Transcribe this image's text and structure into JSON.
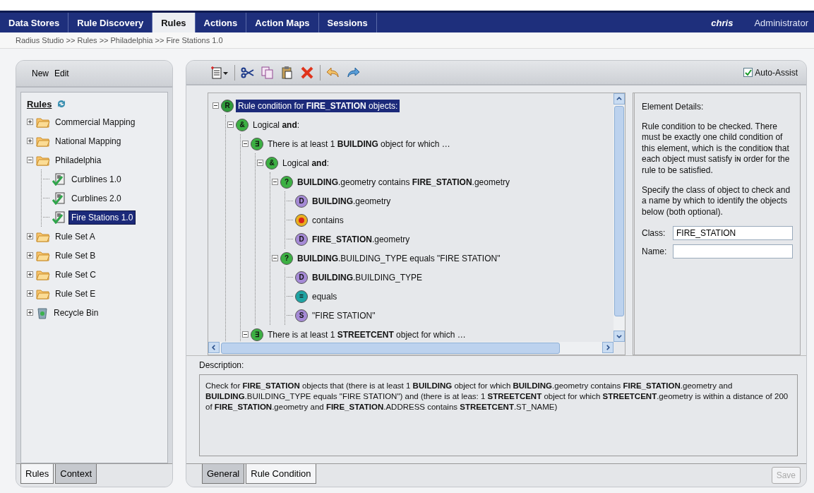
{
  "nav": {
    "tabs": [
      {
        "label": "Data Stores",
        "selected": false
      },
      {
        "label": "Rule Discovery",
        "selected": false
      },
      {
        "label": "Rules",
        "selected": true
      },
      {
        "label": "Actions",
        "selected": false
      },
      {
        "label": "Action Maps",
        "selected": false
      },
      {
        "label": "Sessions",
        "selected": false
      }
    ],
    "user": "chris",
    "role": "Administrator"
  },
  "breadcrumb": "Radius Studio >> Rules >> Philadelphia >> Fire Stations 1.0",
  "sidebar": {
    "menu": [
      "New",
      "Edit"
    ],
    "title": "Rules",
    "tree": [
      {
        "label": "Commercial Mapping",
        "kind": "folder",
        "expanded": false,
        "selected": false
      },
      {
        "label": "National Mapping",
        "kind": "folder",
        "expanded": false,
        "selected": false
      },
      {
        "label": "Philadelphia",
        "kind": "folder",
        "expanded": true,
        "selected": false,
        "children": [
          {
            "label": "Curblines 1.0",
            "kind": "rule",
            "selected": false
          },
          {
            "label": "Curblines 2.0",
            "kind": "rule",
            "selected": false
          },
          {
            "label": "Fire Stations 1.0",
            "kind": "rule",
            "selected": true
          }
        ]
      },
      {
        "label": "Rule Set A",
        "kind": "folder",
        "expanded": false,
        "selected": false
      },
      {
        "label": "Rule Set B",
        "kind": "folder",
        "expanded": false,
        "selected": false
      },
      {
        "label": "Rule Set C",
        "kind": "folder",
        "expanded": false,
        "selected": false
      },
      {
        "label": "Rule Set E",
        "kind": "folder",
        "expanded": false,
        "selected": false
      },
      {
        "label": "Recycle Bin",
        "kind": "bin",
        "expanded": false,
        "selected": false
      }
    ],
    "tabs": [
      {
        "label": "Rules",
        "selected": true
      },
      {
        "label": "Context",
        "selected": false
      }
    ]
  },
  "editor": {
    "auto_assist": {
      "label": "Auto-Assist",
      "checked": true
    },
    "condition_tree": [
      {
        "badge": "R",
        "kind": "rule",
        "text": "Rule condition for **FIRE_STATION** objects:",
        "expanded": true,
        "selected": true,
        "children": [
          {
            "badge": "&",
            "kind": "logical",
            "text": "Logical **and**:",
            "expanded": true,
            "selected": false,
            "children": [
              {
                "badge": "∃",
                "kind": "exists",
                "text": "There is at least 1 **BUILDING** object for which …",
                "expanded": true,
                "selected": false,
                "children": [
                  {
                    "badge": "&",
                    "kind": "logical",
                    "text": "Logical **and**:",
                    "expanded": true,
                    "selected": false,
                    "children": [
                      {
                        "badge": "?",
                        "kind": "test",
                        "text": "**BUILDING**.geometry contains **FIRE_STATION**.geometry",
                        "expanded": true,
                        "selected": false,
                        "children": [
                          {
                            "badge": "D",
                            "kind": "data",
                            "text": "**BUILDING**.geometry",
                            "selected": false
                          },
                          {
                            "kind": "operator",
                            "text": "contains",
                            "selected": false
                          },
                          {
                            "badge": "D",
                            "kind": "data",
                            "text": "**FIRE_STATION**.geometry",
                            "selected": false
                          }
                        ]
                      },
                      {
                        "badge": "?",
                        "kind": "test",
                        "text": "**BUILDING**.BUILDING_TYPE equals \"FIRE STATION\"",
                        "expanded": true,
                        "selected": false,
                        "children": [
                          {
                            "badge": "D",
                            "kind": "data",
                            "text": "**BUILDING**.BUILDING_TYPE",
                            "selected": false
                          },
                          {
                            "badge": "=",
                            "kind": "equals",
                            "text": "equals",
                            "selected": false
                          },
                          {
                            "badge": "S",
                            "kind": "string",
                            "text": "\"FIRE STATION\"",
                            "selected": false
                          }
                        ]
                      }
                    ]
                  }
                ]
              },
              {
                "badge": "∃",
                "kind": "exists",
                "text": "There is at least 1 **STREETCENT** object for which …",
                "expanded": true,
                "selected": false
              }
            ]
          }
        ]
      }
    ],
    "details": {
      "title": "Element Details:",
      "paragraphs": [
        "Rule condition to be checked. There must be exactly one child condition of this element, which is the conditioɴ that each object must satisfy iɴ order for the rule to be satisfied.",
        "Specify the class of object to check and a name by which to identify the objects below (both optional)."
      ],
      "fields": [
        {
          "label": "Class:",
          "value": "FIRE_STATION"
        },
        {
          "label": "Name:"
        }
      ]
    },
    "description": {
      "label": "Description:",
      "text": "Check for **FIRE_STATION** objects that (there is at least 1 **BUILDING** object for which **BUILDING**.geometry contains **FIRE_STATION**.geometry and **BUILDING**.BUILDING_TYPE equals \"FIRE STATION\") and (there is at leas: 1 **STREETCENT** object for which **STREETCENT**.geometry is within a distance of 200 of **FIRE_STATION**.geometry and **FIRE_STATION**.ADDRESS contains **STREETCENT**.ST_NAME)"
    },
    "tabs": [
      {
        "label": "General",
        "selected": false
      },
      {
        "label": "Rule Condition",
        "selected": true
      }
    ],
    "save": {
      "label": "Save",
      "disabled": true
    }
  }
}
